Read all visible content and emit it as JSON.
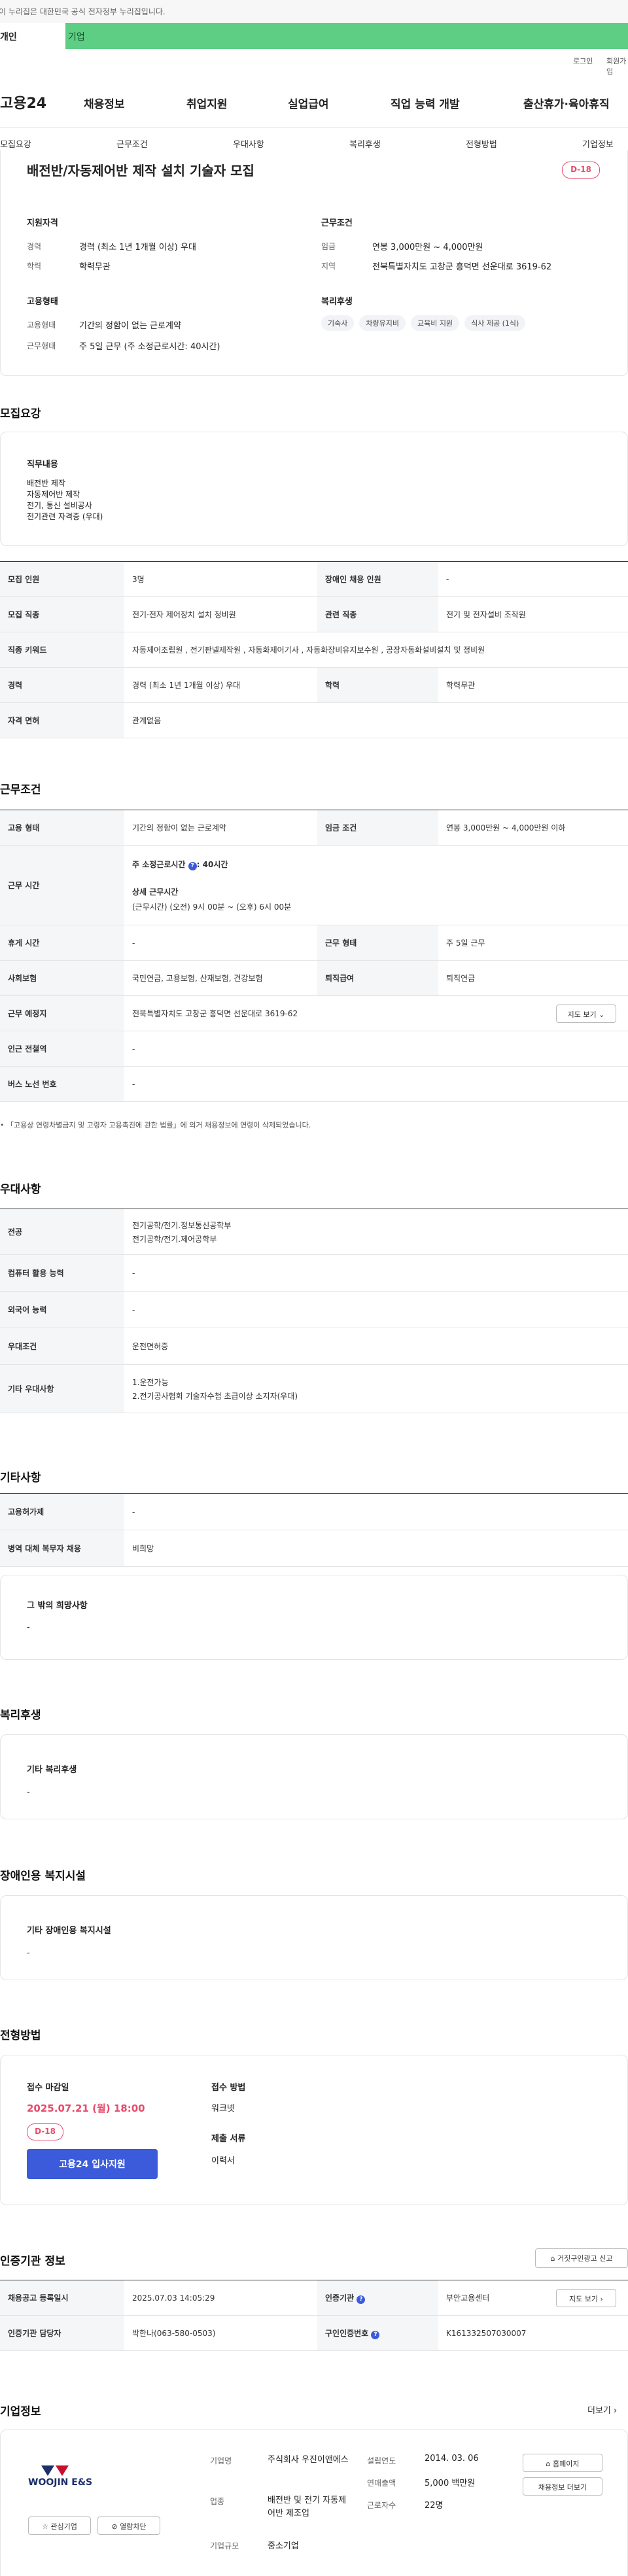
{
  "top_notice": "이 누리집은 대한민국 공식 전자정부 누리집입니다.",
  "user_tabs": [
    "개인",
    "기업"
  ],
  "util": {
    "login": "로그인",
    "join": "회원가입"
  },
  "gnb": {
    "logo": "고용24",
    "menu": [
      "채용정보",
      "취업지원",
      "실업급여",
      "직업 능력 개발",
      "출산휴가·육아휴직"
    ]
  },
  "subnav": [
    "모집요강",
    "근무조건",
    "우대사항",
    "복리후생",
    "전형방법",
    "기업정보"
  ],
  "job": {
    "title": "배전반/자동제어반 제작 설치 기술자 모집",
    "dday": "D-18",
    "qual_h": "지원자격",
    "cond_h": "근무조건",
    "career_l": "경력",
    "career": "경력 (최소 1년 1개월 이상) 우대",
    "edu_l": "학력",
    "edu": "학력무관",
    "wage_l": "임금",
    "wage": "연봉 3,000만원 ~ 4,000만원",
    "region_l": "지역",
    "region": "전북특별자치도 고창군 흥덕면 선운대로 3619-62",
    "emp_h": "고용형태",
    "welfare_h": "복리후생",
    "emptype_l": "고용형태",
    "emptype": "기간의 정함이 없는 근로계약",
    "worktype_l": "근무형태",
    "worktype": "주 5일 근무 (주 소정근로시간: 40시간)",
    "chips": [
      "기숙사",
      "차량유지비",
      "교육비 지원",
      "식사 제공 (1식)"
    ]
  },
  "recruit": {
    "heading": "모집요강",
    "duty_h": "직무내용",
    "duty_lines": [
      "배전반 제작",
      "자동제어반 제작",
      "전기, 통신 설비공사",
      "전기관련 자격증 (우대)"
    ],
    "rows": [
      [
        "모집 인원",
        "3명",
        "장애인 채용 인원",
        "-"
      ],
      [
        "모집 직종",
        "전기·전자 제어장치 설치 정비원",
        "관련 직종",
        "전기 및 전자설비 조작원"
      ],
      [
        "직종 키워드",
        "자동제어조립원 , 전기판넬제작원 , 자동화제어기사 , 자동화장비유지보수원 , 공장자동화설비설치 및 정비원"
      ],
      [
        "경력",
        "경력 (최소 1년 1개월 이상) 우대",
        "학력",
        "학력무관"
      ],
      [
        "자격 면허",
        "관계없음"
      ]
    ]
  },
  "conditions": {
    "heading": "근무조건",
    "emp_l": "고용 형태",
    "emp": "기간의 정함이 없는 근로계약",
    "wage_l": "임금 조건",
    "wage": "연봉 3,000만원 ~ 4,000만원 이하",
    "hours_l": "근무 시간",
    "hours_weekly": "주 소정근로시간",
    "hours_weekly_v": "40시간",
    "hours_detail_h": "상세 근무시간",
    "hours_detail": "(근무시간) (오전) 9시 00분 ~ (오후) 6시 00분",
    "rest_l": "휴게 시간",
    "rest": "-",
    "form_l": "근무 형태",
    "form": "주 5일 근무",
    "ins_l": "사회보험",
    "ins": "국민연금, 고용보험, 산재보험, 건강보험",
    "sev_l": "퇴직급여",
    "sev": "퇴직연금",
    "place_l": "근무 예정지",
    "place": "전북특별자치도 고창군 흥덕면 선운대로 3619-62",
    "map_btn": "지도 보기",
    "subway_l": "인근 전철역",
    "subway": "-",
    "bus_l": "버스 노선 번호",
    "bus": "-",
    "note": "「고용상 연령차별금지 및 고령자 고용촉진에 관한 법률」에 의거 채용정보에 연령이 삭제되었습니다."
  },
  "preference": {
    "heading": "우대사항",
    "rows": [
      [
        "전공",
        "전기공학/전기.정보통신공학부",
        "전기공학/전기.제어공학부"
      ],
      [
        "컴퓨터 활용 능력",
        "-"
      ],
      [
        "외국어 능력",
        "-"
      ],
      [
        "우대조건",
        "운전면허증"
      ],
      [
        "기타 우대사항",
        "1.운전가능",
        "2.전기공사협회 기술자수첩 초급이상 소지자(우대)"
      ]
    ]
  },
  "etc": {
    "heading": "기타사항",
    "rows": [
      [
        "고용허가제",
        "-"
      ],
      [
        "병역 대체 복무자 채용",
        "비희망"
      ]
    ],
    "other_h": "그 밖의 희망사항",
    "other": "-"
  },
  "welfare": {
    "heading": "복리후생",
    "box_h": "기타 복리후생",
    "box": "-"
  },
  "disability": {
    "heading": "장애인용 복지시설",
    "box_h": "기타 장애인용 복지시설",
    "box": "-"
  },
  "process": {
    "heading": "전형방법",
    "deadline_h": "접수 마감일",
    "deadline": "2025.07.21 (월) 18:00",
    "dday": "D-18",
    "apply_btn": "고용24 입사지원",
    "method_h": "접수 방법",
    "method": "워크넷",
    "docs_h": "제출 서류",
    "docs": "이력서"
  },
  "agency": {
    "heading": "인증기관 정보",
    "report_btn": "거짓구인광고 신고",
    "reg_l": "채용공고 등록일시",
    "reg": "2025.07.03 14:05:29",
    "org_l": "인증기관",
    "org": "부안고용센터",
    "map_btn": "지도 보기",
    "mgr_l": "인증기관 담당자",
    "mgr": "박한나(063-580-0503)",
    "no_l": "구인인증번호",
    "no": "K161332507030007"
  },
  "company": {
    "heading": "기업정보",
    "more": "더보기",
    "logo": "WOOJIN E&S",
    "fav": "관심기업",
    "block": "열람차단",
    "f1_l": "기업명",
    "f1": "주식회사 우진이앤에스",
    "f2_l": "업종",
    "f2": "배전반 및 전기 자동제어반 제조업",
    "f3_l": "기업규모",
    "f3": "중소기업",
    "g1_l": "설립연도",
    "g1": "2014. 03. 06",
    "g2_l": "연매출액",
    "g2": "5,000 백만원",
    "g3_l": "근로자수",
    "g3": "22명",
    "home_btn": "홈페이지",
    "more_btn": "채용정보 더보기"
  },
  "colors": {
    "accent": "#5dce84",
    "primary_btn": "#3b5bdb",
    "dday": "#e94b6b"
  }
}
